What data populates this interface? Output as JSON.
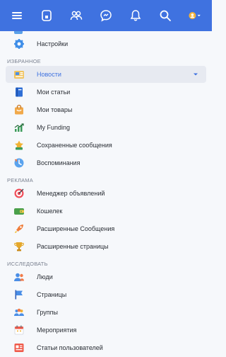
{
  "topbar": {
    "icons": [
      "hamburger-icon",
      "home-icon",
      "friends-icon",
      "messenger-icon",
      "bell-icon",
      "search-icon",
      "avatar"
    ],
    "color": "#3f72e0"
  },
  "menu": {
    "settings_label": "Настройки",
    "sections": {
      "favorites": "ИЗБРАННОЕ",
      "ads": "РЕКЛАМА",
      "explore": "ИССЛЕДОВАТЬ"
    },
    "favorites": [
      {
        "label": "Новости",
        "icon": "news-icon",
        "active": true
      },
      {
        "label": "Мои статьи",
        "icon": "book-icon"
      },
      {
        "label": "Мои товары",
        "icon": "shopping-bag-icon"
      },
      {
        "label": "My Funding",
        "icon": "funding-chart-icon"
      },
      {
        "label": "Сохраненные сообщения",
        "icon": "bookmark-icon"
      },
      {
        "label": "Воспоминания",
        "icon": "memories-icon"
      }
    ],
    "ads": [
      {
        "label": "Менеджер объявлений",
        "icon": "target-icon"
      },
      {
        "label": "Кошелек",
        "icon": "wallet-icon"
      },
      {
        "label": "Расширенные Сообщения",
        "icon": "rocket-icon"
      },
      {
        "label": "Расширенные страницы",
        "icon": "trophy-icon"
      }
    ],
    "explore": [
      {
        "label": "Люди",
        "icon": "people-icon"
      },
      {
        "label": "Страницы",
        "icon": "flag-icon"
      },
      {
        "label": "Группы",
        "icon": "groups-icon"
      },
      {
        "label": "Мероприятия",
        "icon": "calendar-icon"
      },
      {
        "label": "Статьи пользователей",
        "icon": "articles-icon"
      }
    ]
  }
}
